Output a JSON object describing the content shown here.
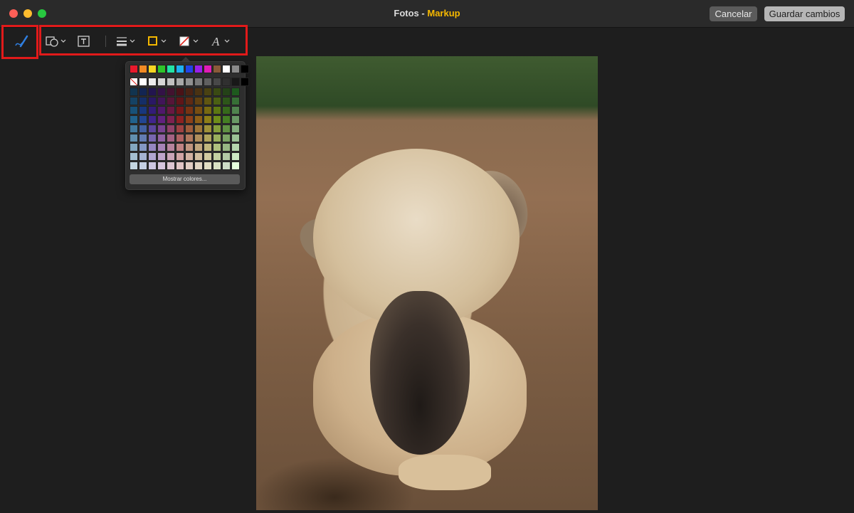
{
  "window": {
    "app_name": "Fotos",
    "separator": " - ",
    "mode_name": "Markup",
    "mode_color": "#f5b800"
  },
  "header_buttons": {
    "cancel_label": "Cancelar",
    "save_label": "Guardar cambios"
  },
  "toolbar": {
    "tools": [
      {
        "name": "sketch-tool",
        "icon": "pen-scribble-icon",
        "color": "#2f7fe0"
      },
      {
        "name": "shapes-tool",
        "icon": "shapes-icon",
        "has_menu": true
      },
      {
        "name": "text-tool",
        "icon": "text-box-icon"
      },
      {
        "name": "line-style-tool",
        "icon": "line-weight-icon",
        "has_menu": true
      },
      {
        "name": "border-color-tool",
        "icon": "border-color-square-icon",
        "color": "#f5b800",
        "has_menu": true
      },
      {
        "name": "fill-color-tool",
        "icon": "fill-color-none-icon",
        "has_menu": true
      },
      {
        "name": "text-style-tool",
        "icon": "text-style-A-icon",
        "has_menu": true
      }
    ],
    "highlight_color": "#e11a1a"
  },
  "color_popover": {
    "row1_colors": [
      "#e8192c",
      "#f08a24",
      "#f5d523",
      "#2ec52b",
      "#23e2a4",
      "#1fb1f0",
      "#2244e6",
      "#9b1fe8",
      "#e01cb7",
      "#8a5a3a",
      "#ffffff",
      "#8a8a8a",
      "#000000"
    ],
    "row2_colors": [
      "none",
      "#ffffff",
      "#ececec",
      "#d6d6d6",
      "#c0c0c0",
      "#a8a8a8",
      "#909090",
      "#787878",
      "#606060",
      "#484848",
      "#303030",
      "#181818",
      "#000000"
    ],
    "grid_hues": [
      "#1a5d8a",
      "#1b3f8f",
      "#3a1f8a",
      "#5c1a7a",
      "#7a1a4a",
      "#8a1a1a",
      "#8a3a12",
      "#8a5a10",
      "#8a7a10",
      "#6a8a12",
      "#3e7a1c"
    ],
    "more_colors_label": "Mostrar colores..."
  }
}
